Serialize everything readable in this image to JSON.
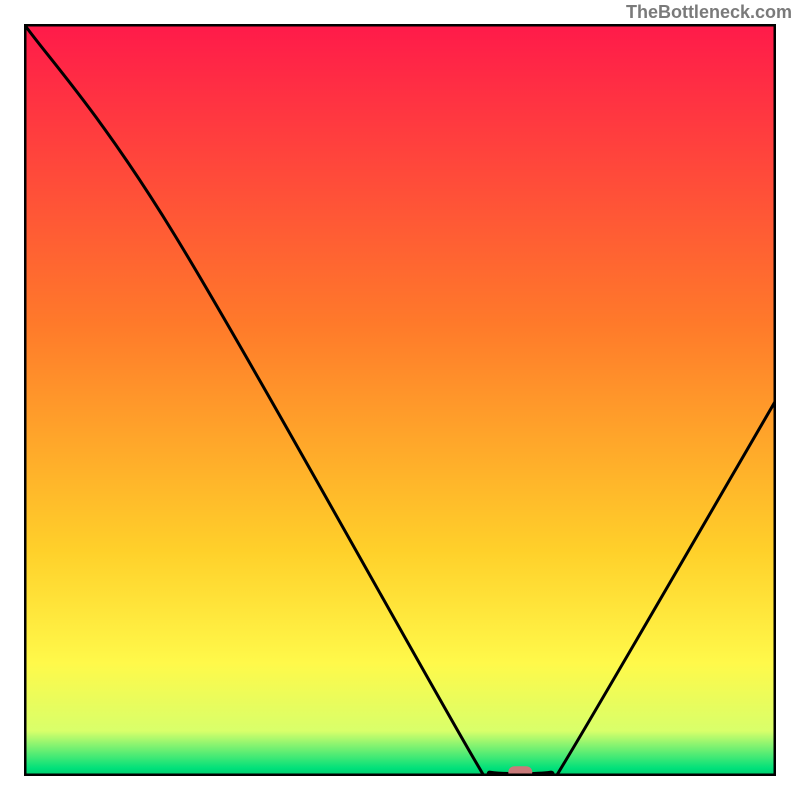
{
  "watermark": "TheBottleneck.com",
  "chart_data": {
    "type": "line",
    "title": "",
    "xlabel": "",
    "ylabel": "",
    "xlim": [
      0,
      100
    ],
    "ylim": [
      0,
      100
    ],
    "curve": [
      {
        "x": 0,
        "y": 100
      },
      {
        "x": 20,
        "y": 72
      },
      {
        "x": 60,
        "y": 2
      },
      {
        "x": 62,
        "y": 0.5
      },
      {
        "x": 70,
        "y": 0.5
      },
      {
        "x": 72,
        "y": 2
      },
      {
        "x": 100,
        "y": 50
      }
    ],
    "marker": {
      "x": 66,
      "y": 0.5,
      "color": "#c97a7a"
    },
    "gradient_stops": [
      {
        "offset": 0.0,
        "color": "#ff1a4a"
      },
      {
        "offset": 0.4,
        "color": "#ff7a2a"
      },
      {
        "offset": 0.7,
        "color": "#ffd02a"
      },
      {
        "offset": 0.85,
        "color": "#fff94a"
      },
      {
        "offset": 0.94,
        "color": "#d9ff6a"
      },
      {
        "offset": 0.99,
        "color": "#00e07a"
      },
      {
        "offset": 1.0,
        "color": "#00c96a"
      }
    ],
    "frame_color": "#000000"
  }
}
